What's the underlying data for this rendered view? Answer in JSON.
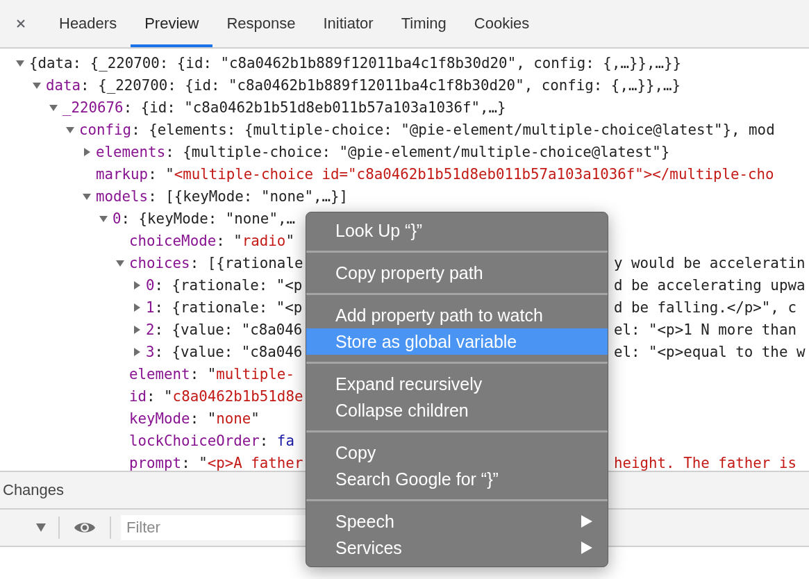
{
  "tabs": [
    {
      "label": "Headers",
      "selected": false
    },
    {
      "label": "Preview",
      "selected": true
    },
    {
      "label": "Response",
      "selected": false
    },
    {
      "label": "Initiator",
      "selected": false
    },
    {
      "label": "Timing",
      "selected": false
    },
    {
      "label": "Cookies",
      "selected": false
    }
  ],
  "tree": [
    {
      "kind": "object",
      "expanded": true,
      "value": [
        {
          "kind": "plain",
          "text": "{data: {_220700: {id: \"c8a0462b1b889f12011ba4c1f8b30d20\", config: {,…}},…}}"
        }
      ],
      "children": [
        {
          "kind": "object",
          "expanded": true,
          "key": "data",
          "value": [
            {
              "kind": "plain",
              "text": ": {_220700: {id: \"c8a0462b1b889f12011ba4c1f8b30d20\", config: {,…}},…}"
            }
          ],
          "children": [
            {
              "kind": "object",
              "expanded": true,
              "key": "_220676",
              "value": [
                {
                  "kind": "plain",
                  "text": ": {id: \"c8a0462b1b51d8eb011b57a103a1036f\",…}"
                }
              ],
              "children": [
                {
                  "kind": "object",
                  "expanded": true,
                  "key": "config",
                  "value": [
                    {
                      "kind": "plain",
                      "text": ": {elements: {multiple-choice: \"@pie-element/multiple-choice@latest\"}, mod"
                    }
                  ],
                  "children": [
                    {
                      "kind": "object",
                      "expanded": false,
                      "key": "elements",
                      "value": [
                        {
                          "kind": "plain",
                          "text": ": {multiple-choice: \"@pie-element/multiple-choice@latest\"}"
                        }
                      ]
                    },
                    {
                      "kind": "leaf",
                      "key": "markup",
                      "value": [
                        {
                          "kind": "plain",
                          "text": ": \""
                        },
                        {
                          "kind": "string",
                          "text": "<multiple-choice id=\"c8a0462b1b51d8eb011b57a103a1036f\"></multiple-cho"
                        }
                      ]
                    },
                    {
                      "kind": "object",
                      "expanded": true,
                      "key": "models",
                      "value": [
                        {
                          "kind": "plain",
                          "text": ": [{keyMode: \"none\",…}]"
                        }
                      ],
                      "children": [
                        {
                          "kind": "object",
                          "expanded": true,
                          "key": "0",
                          "value": [
                            {
                              "kind": "plain",
                              "text": ": {keyMode: \"none\",…"
                            }
                          ],
                          "children": [
                            {
                              "kind": "leaf",
                              "key": "choiceMode",
                              "value": [
                                {
                                  "kind": "plain",
                                  "text": ": \""
                                },
                                {
                                  "kind": "string",
                                  "text": "radio"
                                },
                                {
                                  "kind": "plain",
                                  "text": "\""
                                }
                              ]
                            },
                            {
                              "kind": "object",
                              "expanded": true,
                              "key": "choices",
                              "value": [
                                {
                                  "kind": "plain",
                                  "text": ": [{rationale"
                                }
                              ],
                              "after": [
                                {
                                  "kind": "plain",
                                  "text": "y would be acceleratin"
                                }
                              ],
                              "children": [
                                {
                                  "kind": "object",
                                  "expanded": false,
                                  "key": "0",
                                  "value": [
                                    {
                                      "kind": "plain",
                                      "text": ": {rationale: \"<p"
                                    }
                                  ],
                                  "after": [
                                    {
                                      "kind": "plain",
                                      "text": "d be accelerating upwa"
                                    }
                                  ]
                                },
                                {
                                  "kind": "object",
                                  "expanded": false,
                                  "key": "1",
                                  "value": [
                                    {
                                      "kind": "plain",
                                      "text": ": {rationale: \"<p"
                                    }
                                  ],
                                  "after": [
                                    {
                                      "kind": "plain",
                                      "text": "d be falling.</p>\", c"
                                    }
                                  ]
                                },
                                {
                                  "kind": "object",
                                  "expanded": false,
                                  "key": "2",
                                  "value": [
                                    {
                                      "kind": "plain",
                                      "text": ": {value: \"c8a046"
                                    }
                                  ],
                                  "after": [
                                    {
                                      "kind": "plain",
                                      "text": "el: \"<p>1 N more than"
                                    }
                                  ]
                                },
                                {
                                  "kind": "object",
                                  "expanded": false,
                                  "key": "3",
                                  "value": [
                                    {
                                      "kind": "plain",
                                      "text": ": {value: \"c8a046"
                                    }
                                  ],
                                  "after": [
                                    {
                                      "kind": "plain",
                                      "text": "el: \"<p>equal to the w"
                                    }
                                  ]
                                }
                              ]
                            },
                            {
                              "kind": "leaf",
                              "key": "element",
                              "value": [
                                {
                                  "kind": "plain",
                                  "text": ": \""
                                },
                                {
                                  "kind": "string",
                                  "text": "multiple-"
                                }
                              ]
                            },
                            {
                              "kind": "leaf",
                              "key": "id",
                              "value": [
                                {
                                  "kind": "plain",
                                  "text": ": \""
                                },
                                {
                                  "kind": "string",
                                  "text": "c8a0462b1b51d8e"
                                }
                              ]
                            },
                            {
                              "kind": "leaf",
                              "key": "keyMode",
                              "value": [
                                {
                                  "kind": "plain",
                                  "text": ": \""
                                },
                                {
                                  "kind": "string",
                                  "text": "none"
                                },
                                {
                                  "kind": "plain",
                                  "text": "\""
                                }
                              ]
                            },
                            {
                              "kind": "leaf",
                              "key": "lockChoiceOrder",
                              "value": [
                                {
                                  "kind": "plain",
                                  "text": ": "
                                },
                                {
                                  "kind": "keyword",
                                  "text": "fa"
                                }
                              ]
                            },
                            {
                              "kind": "leaf",
                              "key": "prompt",
                              "value": [
                                {
                                  "kind": "plain",
                                  "text": ": \""
                                },
                                {
                                  "kind": "string",
                                  "text": "<p>A father"
                                }
                              ],
                              "after": [
                                {
                                  "kind": "string",
                                  "text": "height. The father is"
                                }
                              ]
                            }
                          ]
                        }
                      ]
                    }
                  ]
                }
              ]
            }
          ]
        }
      ]
    }
  ],
  "changes": {
    "title": "Changes",
    "filter": {
      "placeholder": "Filter"
    }
  },
  "context_menu": {
    "groups": [
      [
        {
          "label": "Look Up “}”",
          "selected": false,
          "submenu": false
        }
      ],
      [
        {
          "label": "Copy property path",
          "selected": false,
          "submenu": false
        }
      ],
      [
        {
          "label": "Add property path to watch",
          "selected": false,
          "submenu": false
        },
        {
          "label": "Store as global variable",
          "selected": true,
          "submenu": false
        }
      ],
      [
        {
          "label": "Expand recursively",
          "selected": false,
          "submenu": false
        },
        {
          "label": "Collapse children",
          "selected": false,
          "submenu": false
        }
      ],
      [
        {
          "label": "Copy",
          "selected": false,
          "submenu": false
        },
        {
          "label": "Search Google for “}”",
          "selected": false,
          "submenu": false
        }
      ],
      [
        {
          "label": "Speech",
          "selected": false,
          "submenu": true
        },
        {
          "label": "Services",
          "selected": false,
          "submenu": true
        }
      ]
    ]
  }
}
